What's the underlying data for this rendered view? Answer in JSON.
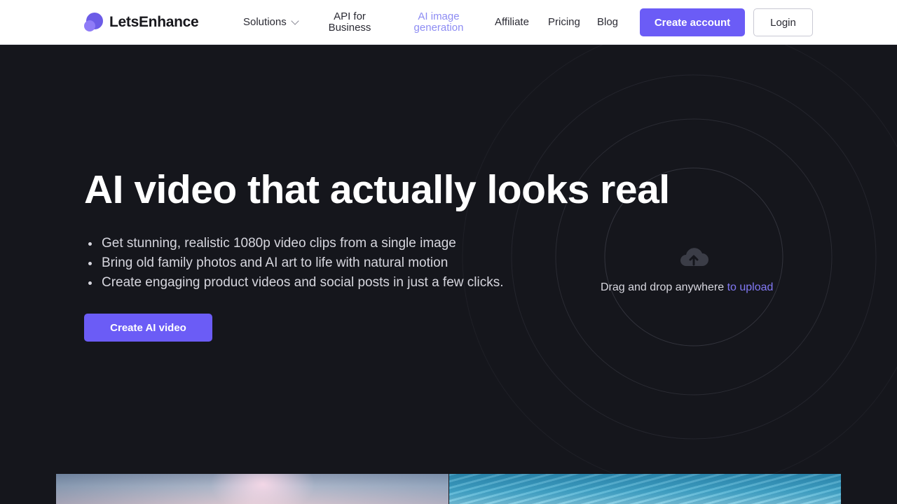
{
  "brand": {
    "name": "LetsEnhance"
  },
  "nav": {
    "solutions": "Solutions",
    "api_line1": "API for",
    "api_line2": "Business",
    "gen_line1": "AI image",
    "gen_line2": "generation",
    "affiliate": "Affiliate",
    "pricing": "Pricing",
    "blog": "Blog"
  },
  "header_buttons": {
    "create_account": "Create account",
    "login": "Login"
  },
  "hero": {
    "headline": "AI video that actually looks real",
    "bullets": [
      "Get stunning, realistic 1080p video clips from a single image",
      "Bring old family photos and AI art to life with natural motion",
      "Create engaging product videos and social posts in just a few clicks."
    ],
    "cta": "Create AI video"
  },
  "upload": {
    "text": "Drag and drop anywhere ",
    "link": "to upload",
    "icon": "cloud-upload-icon"
  },
  "colors": {
    "accent": "#6b5cf6",
    "active_nav": "#8d8cf3",
    "hero_bg": "#15161c",
    "link": "#8279f5"
  }
}
